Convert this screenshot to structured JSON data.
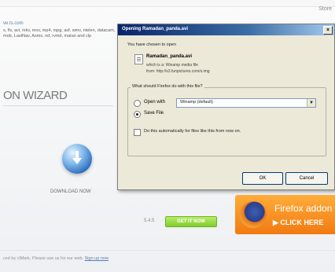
{
  "page": {
    "top_right_link": "Store",
    "file_link": "ve.ts.com",
    "formats_text": "s, flv, avi, mkv, mov, mp4, mpg, asf, wmv, ntelen, datacam, mob, LastNav, Asmx, nd, rvmd, matan and clp",
    "wizard_heading": "ON WIZARD",
    "download_now": "DOWNLOAD NOW",
    "version": "5.4.5",
    "get_it_button": "GET IT NOW",
    "firefox_title": "Firefox addon",
    "firefox_cta": "▶ CLICK HERE",
    "footer_text": "ced by clMark. Please use us for our web. ",
    "footer_link": "Sign up now"
  },
  "dialog": {
    "title": "Opening Ramadan_panda.avi",
    "intro": "You have chosen to open",
    "file_name": "Ramadan_panda.avi",
    "which_is": "which is a: Winamp media file",
    "from": "from: http://s3.funpictures.com/s.img",
    "question": "What should Firefox do with this file?",
    "open_with_label": "Open with",
    "open_with_app": "Winamp (default)",
    "save_file_label": "Save File",
    "save_file_selected": true,
    "auto_checkbox_label": "Do this automatically for files like this from now on.",
    "ok_label": "OK",
    "cancel_label": "Cancel"
  },
  "colors": {
    "title_bar_start": "#0a246a",
    "dialog_face": "#ece9d8",
    "firefox_orange": "#f17a11",
    "get_it_green": "#7fcd2c"
  },
  "icons": [
    "globe-download-icon",
    "firefox-icon",
    "file-icon",
    "close-icon",
    "dropdown-arrow-icon"
  ]
}
